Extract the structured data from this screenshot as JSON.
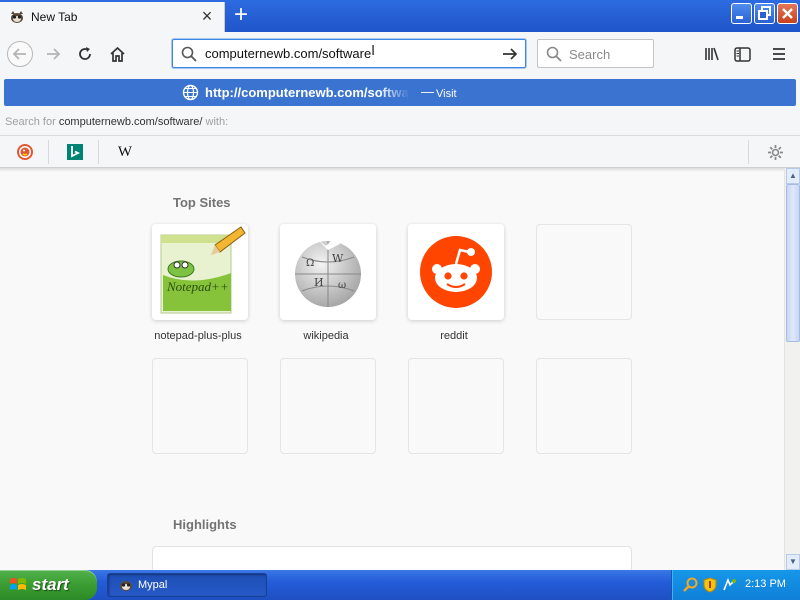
{
  "window": {
    "tab_title": "New Tab",
    "new_tab_icon": "plus-icon",
    "controls": [
      "minimize-icon",
      "maximize-icon",
      "close-icon"
    ]
  },
  "navbar": {
    "url_value": "computernewb.com/software",
    "search_placeholder": "Search",
    "icons": [
      "back-arrow-icon",
      "forward-arrow-icon",
      "reload-icon",
      "home-icon",
      "library-icon",
      "sidebar-icon",
      "hamburger-menu-icon"
    ]
  },
  "dropdown": {
    "visit_url": "http://computernewb.com/software/",
    "visit_separator": "—",
    "visit_action": "Visit",
    "search_prefix": "Search for",
    "search_query": "computernewb.com/software/",
    "search_suffix": "with:",
    "engines": [
      "duckduckgo-icon",
      "bing-icon",
      "wikipedia-icon"
    ]
  },
  "content": {
    "top_sites_title": "Top Sites",
    "highlights_title": "Highlights",
    "top_sites": [
      {
        "label": "notepad-plus-plus",
        "icon": "notepad-plus-plus-icon"
      },
      {
        "label": "wikipedia",
        "icon": "wikipedia-globe-icon"
      },
      {
        "label": "reddit",
        "icon": "reddit-alien-icon"
      }
    ],
    "empty_tiles": 5
  },
  "taskbar": {
    "start_label": "start",
    "task_label": "Mypal",
    "clock": "2:13 PM"
  },
  "colors": {
    "titlebar": "#245cd8",
    "accent_selection": "#3a73d0",
    "reddit": "#ff4500",
    "start_green": "#3a9c32"
  }
}
